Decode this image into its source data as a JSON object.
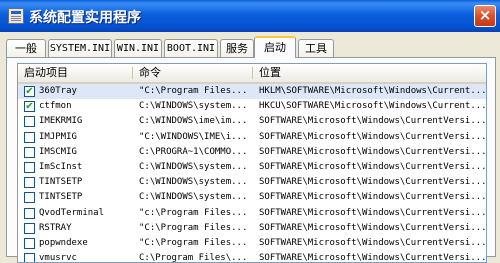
{
  "window": {
    "title": "系统配置实用程序",
    "close_glyph": "×"
  },
  "tabs": [
    {
      "label": "一般",
      "mono": false
    },
    {
      "label": "SYSTEM.INI",
      "mono": true
    },
    {
      "label": "WIN.INI",
      "mono": true
    },
    {
      "label": "BOOT.INI",
      "mono": true
    },
    {
      "label": "服务",
      "mono": false
    },
    {
      "label": "启动",
      "mono": false,
      "active": true
    },
    {
      "label": "工具",
      "mono": false
    }
  ],
  "columns": {
    "item": "启动项目",
    "command": "命令",
    "location": "位置"
  },
  "rows": [
    {
      "checked": true,
      "item": "360Tray",
      "command": "\"C:\\Program Files...",
      "location": "HKLM\\SOFTWARE\\Microsoft\\Windows\\Current...",
      "selected": true
    },
    {
      "checked": true,
      "item": "ctfmon",
      "command": "C:\\WINDOWS\\system...",
      "location": "HKCU\\SOFTWARE\\Microsoft\\Windows\\Current..."
    },
    {
      "checked": false,
      "item": "IMEKRMIG",
      "command": "C:\\WINDOWS\\ime\\im...",
      "location": "SOFTWARE\\Microsoft\\Windows\\CurrentVersi..."
    },
    {
      "checked": false,
      "item": "IMJPMIG",
      "command": "\"C:\\WINDOWS\\IME\\i...",
      "location": "SOFTWARE\\Microsoft\\Windows\\CurrentVersi..."
    },
    {
      "checked": false,
      "item": "IMSCMIG",
      "command": "C:\\PROGRA~1\\COMMO...",
      "location": "SOFTWARE\\Microsoft\\Windows\\CurrentVersi..."
    },
    {
      "checked": false,
      "item": "ImScInst",
      "command": "C:\\WINDOWS\\system...",
      "location": "SOFTWARE\\Microsoft\\Windows\\CurrentVersi..."
    },
    {
      "checked": false,
      "item": "TINTSETP",
      "command": "C:\\WINDOWS\\system...",
      "location": "SOFTWARE\\Microsoft\\Windows\\CurrentVersi..."
    },
    {
      "checked": false,
      "item": "TINTSETP",
      "command": "C:\\WINDOWS\\system...",
      "location": "SOFTWARE\\Microsoft\\Windows\\CurrentVersi..."
    },
    {
      "checked": false,
      "item": "QvodTerminal",
      "command": "\"c:\\Program Files...",
      "location": "SOFTWARE\\Microsoft\\Windows\\CurrentVersi..."
    },
    {
      "checked": false,
      "item": "RSTRAY",
      "command": "\"C:\\Program Files...",
      "location": "SOFTWARE\\Microsoft\\Windows\\CurrentVersi..."
    },
    {
      "checked": false,
      "item": "popwndexe",
      "command": "\"C:\\Program Files...",
      "location": "SOFTWARE\\Microsoft\\Windows\\CurrentVersi..."
    },
    {
      "checked": false,
      "item": "vmusrvc",
      "command": "C:\\Program Files\\...",
      "location": "SOFTWARE\\Microsoft\\Windows\\CurrentVersi..."
    }
  ]
}
